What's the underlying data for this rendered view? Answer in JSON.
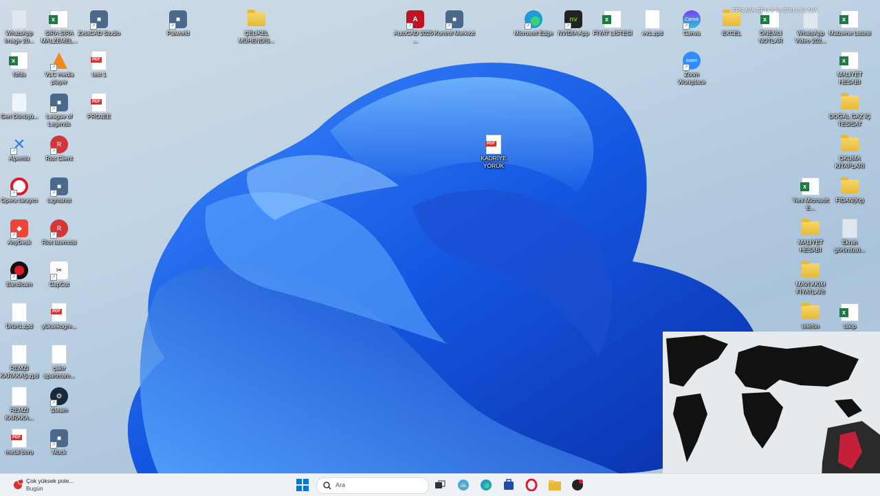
{
  "desktop": {
    "icons": [
      {
        "label": "WhatsApp Image 20...",
        "type": "img"
      },
      {
        "label": "SIRA SIRA MALZEMEL...",
        "type": "xls"
      },
      {
        "label": "ZetaCAD Studio",
        "type": "app"
      },
      {
        "label": "Palworld",
        "type": "app"
      },
      {
        "label": "ÇELİKEL MÜHENDİS...",
        "type": "folder"
      },
      {
        "label": "AutoCAD 2025 - ...",
        "type": "autocad"
      },
      {
        "label": "Kontrol Merkezi",
        "type": "app"
      },
      {
        "label": "Microsoft Edge",
        "type": "edge"
      },
      {
        "label": "NVIDIA App",
        "type": "nvidia"
      },
      {
        "label": "FİYAT LİSTESİ",
        "type": "xls"
      },
      {
        "label": "ev1.zpd",
        "type": "doc"
      },
      {
        "label": "Canva",
        "type": "canva"
      },
      {
        "label": "EXCEL",
        "type": "folder"
      },
      {
        "label": "ÖNEMLİ NOTLAR",
        "type": "xls"
      },
      {
        "label": "WhatsApp Video 202...",
        "type": "img"
      },
      {
        "label": "Malzeme Listesi",
        "type": "xls"
      },
      {
        "label": "fdfds",
        "type": "xls"
      },
      {
        "label": "VLC media player",
        "type": "vlc"
      },
      {
        "label": "test 1",
        "type": "pdf"
      },
      {
        "label": "Zoom Workplace",
        "type": "zoom"
      },
      {
        "label": "MALİYET HESABI",
        "type": "xls"
      },
      {
        "label": "Geri Dönüşü...",
        "type": "recycle"
      },
      {
        "label": "League of Legends",
        "type": "app"
      },
      {
        "label": "PROJEE",
        "type": "pdf"
      },
      {
        "label": "DOĞAL GAZ İÇ TESİSAT",
        "type": "folder"
      },
      {
        "label": "KADRİYE YÖRÜK",
        "type": "pdf"
      },
      {
        "label": "Alpemix",
        "type": "alpemix"
      },
      {
        "label": "Riot Client",
        "type": "riot"
      },
      {
        "label": "OKUMA KİTAPLARI",
        "type": "folder"
      },
      {
        "label": "Opera tarayıcı",
        "type": "opera"
      },
      {
        "label": "Lightshot",
        "type": "app"
      },
      {
        "label": "Yeni Microsoft E...",
        "type": "xls"
      },
      {
        "label": "FİDAN(Kç)",
        "type": "folder"
      },
      {
        "label": "AnyDesk",
        "type": "anydesk"
      },
      {
        "label": "Riot istemcisi",
        "type": "riot"
      },
      {
        "label": "MALİYET HESABI",
        "type": "folder"
      },
      {
        "label": "Ekran görüntüsü...",
        "type": "img"
      },
      {
        "label": "Bandicam",
        "type": "bandicam"
      },
      {
        "label": "CapCut",
        "type": "capcut"
      },
      {
        "label": "MAVİ AKIM FİYATLARI",
        "type": "folder"
      },
      {
        "label": "Ürün1.zpd",
        "type": "doc"
      },
      {
        "label": "yüksekogre...",
        "type": "pdf"
      },
      {
        "label": "telefon",
        "type": "folder"
      },
      {
        "label": "takip",
        "type": "xls"
      },
      {
        "label": "REMZİ KARAKAŞ.zpd",
        "type": "doc"
      },
      {
        "label": "çakır apartmanı...",
        "type": "doc"
      },
      {
        "label": "REMZİ KARAKA...",
        "type": "doc"
      },
      {
        "label": "Steam",
        "type": "steam"
      },
      {
        "label": "metal boru",
        "type": "pdf"
      },
      {
        "label": "Muck",
        "type": "app"
      }
    ]
  },
  "overlay": {
    "text": "FPS N/A   GPU 6 %   CPU 6 %   N/A"
  },
  "taskbar": {
    "notification": {
      "title": "Çok yüksek pole...",
      "subtitle": "Bugün",
      "badge": "1"
    },
    "search_placeholder": "Ara",
    "pinned": [
      {
        "name": "start-button",
        "icon": "windows-icon"
      },
      {
        "name": "task-view-button",
        "icon": "task-view-icon"
      },
      {
        "name": "copilot-button",
        "icon": "copilot-icon"
      },
      {
        "name": "edge-button",
        "icon": "edge-icon"
      },
      {
        "name": "store-button",
        "icon": "store-icon"
      },
      {
        "name": "opera-button",
        "icon": "opera-icon"
      },
      {
        "name": "file-explorer-button",
        "icon": "folder-icon"
      },
      {
        "name": "chatgpt-button",
        "icon": "chatgpt-icon"
      }
    ]
  },
  "colors": {
    "accent": "#0067c0",
    "excel": "#1d7a43",
    "pdf": "#d9302c",
    "folder": "#e8b936"
  }
}
